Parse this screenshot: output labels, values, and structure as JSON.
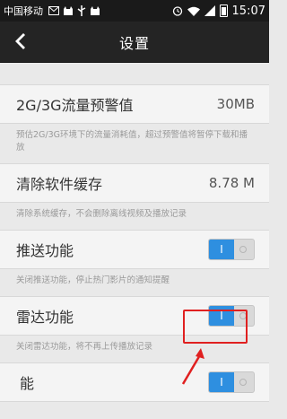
{
  "status_bar": {
    "carrier": "中国移动",
    "left_icons": [
      "message-icon",
      "cat-icon",
      "usb-icon",
      "cat-icon"
    ],
    "right_icons": [
      "alarm-icon",
      "wifi-icon",
      "signal-icon",
      "battery-icon"
    ],
    "time": "15:07"
  },
  "header": {
    "back_icon": "chevron-left-icon",
    "title": "设置"
  },
  "settings": {
    "traffic_warning": {
      "label": "2G/3G流量预警值",
      "value": "30MB",
      "description": "预估2G/3G环境下的流量消耗值，超过预警值将暂停下载和播放"
    },
    "clear_cache": {
      "label": "清除软件缓存",
      "value": "8.78 M",
      "description": "清除系统缓存，不会删除离线视频及播放记录"
    },
    "push": {
      "label": "推送功能",
      "toggle_on_label": "I",
      "enabled": true,
      "description": "关闭推送功能，停止热门影片的通知提醒"
    },
    "radar": {
      "label": "雷达功能",
      "toggle_on_label": "I",
      "enabled": true,
      "description": "关闭雷达功能，将不再上传播放记录"
    },
    "partial": {
      "label": "能",
      "toggle_on_label": "I",
      "enabled": true
    }
  },
  "annotation": {
    "color": "#e02020"
  },
  "colors": {
    "accent": "#2e8fe0",
    "title_bar": "#242424"
  }
}
